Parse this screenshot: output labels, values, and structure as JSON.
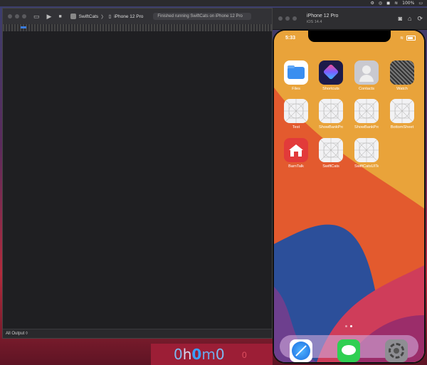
{
  "menubar": {
    "battery_text": "100%",
    "icons": [
      "gear-icon",
      "search-icon",
      "control-center-icon",
      "wifi-icon"
    ]
  },
  "xcode": {
    "scheme": "SwiftCats",
    "destination": "iPhone 12 Pro",
    "status": "Finished running SwiftCats on iPhone 12 Pro",
    "output_filter": "All Output ◊"
  },
  "simulator": {
    "device_name": "iPhone 12 Pro",
    "os_version": "iOS 14.4",
    "status_time": "5:33",
    "apps": [
      {
        "label": "Files"
      },
      {
        "label": "Shortcuts"
      },
      {
        "label": "Contacts"
      },
      {
        "label": "Watch"
      },
      {
        "label": "Test"
      },
      {
        "label": "ShowBankPro..."
      },
      {
        "label": "ShowBankPro..."
      },
      {
        "label": "BottomSheet"
      },
      {
        "label": "BarnTalk"
      },
      {
        "label": "SwiftCats"
      },
      {
        "label": "SwiftCatsUITes..."
      }
    ],
    "dock": [
      "safari-icon",
      "messages-icon",
      "settings-icon"
    ],
    "page_indicator": {
      "pages": 2,
      "current": 2
    }
  },
  "counter": {
    "d1": "0",
    "h": "h",
    "d2": "0",
    "m": "m",
    "d3": "0",
    "extra": "0",
    "colors": {
      "zero": "#7dbbf2",
      "letter": "#d8d8f0",
      "bright": "#3aa0ff",
      "m": "#6fa8e8"
    }
  }
}
